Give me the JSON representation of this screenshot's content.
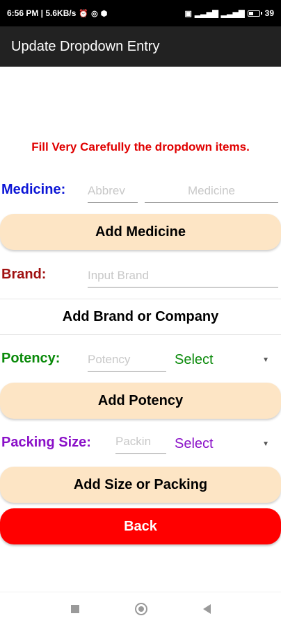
{
  "status_bar": {
    "time_info": "6:56 PM | 5.6KB/s",
    "battery": "39"
  },
  "app_bar": {
    "title": "Update Dropdown Entry"
  },
  "warning": "Fill Very Carefully the dropdown items.",
  "medicine": {
    "label": "Medicine:",
    "abbrev_placeholder": "Abbrev",
    "name_placeholder": "Medicine",
    "add_button": "Add Medicine",
    "color": "#0a14d6"
  },
  "brand": {
    "label": "Brand:",
    "placeholder": "Input Brand",
    "add_button": "Add Brand or Company",
    "color": "#a01010"
  },
  "potency": {
    "label": "Potency:",
    "placeholder": "Potency",
    "select_value": "Select",
    "add_button": "Add Potency",
    "color": "#0a8a0a"
  },
  "packing": {
    "label": "Packing Size:",
    "placeholder": "Packin",
    "select_value": "Select",
    "add_button": "Add Size or Packing",
    "color": "#8a10c8"
  },
  "back_button": "Back",
  "colors": {
    "warning": "#e00000",
    "button_peach": "#fde5c5",
    "button_red": "#ff0000",
    "app_bar": "#222222"
  }
}
